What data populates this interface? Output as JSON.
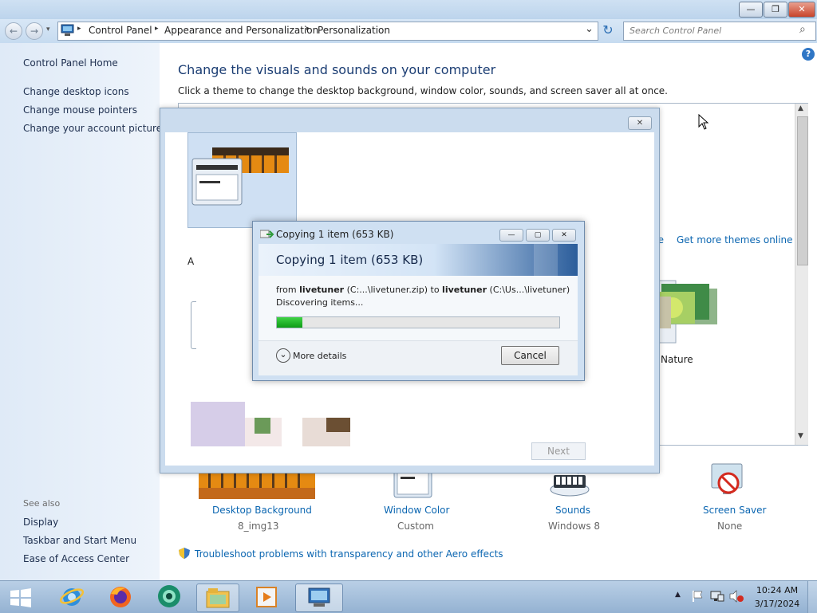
{
  "window": {
    "min_label": "—",
    "max_label": "❐",
    "close_label": "✕"
  },
  "nav": {
    "back_icon": "←",
    "forward_icon": "→",
    "recent_icon": "▾",
    "breadcrumb": [
      "Control Panel",
      "Appearance and Personalization",
      "Personalization"
    ],
    "sep": "▸",
    "dropdown_icon": "⌄",
    "refresh_icon": "↻",
    "search_placeholder": "Search Control Panel",
    "search_icon": "⌕"
  },
  "sidebar": {
    "home": "Control Panel Home",
    "links": [
      "Change desktop icons",
      "Change mouse pointers",
      "Change your account picture"
    ],
    "see_also_title": "See also",
    "see_also": [
      "Display",
      "Taskbar and Start Menu",
      "Ease of Access Center"
    ]
  },
  "main": {
    "title": "Change the visuals and sounds on your computer",
    "subtitle": "Click a theme to change the desktop background, window color, sounds, and screen saver all at once.",
    "help_icon": "?",
    "save_theme_fragment": "heme",
    "get_more_themes": "Get more themes online",
    "nature_label": "Nature",
    "partial_label": "A",
    "bottom_items": [
      {
        "label": "Desktop Background",
        "sub": "8_img13"
      },
      {
        "label": "Window Color",
        "sub": "Custom"
      },
      {
        "label": "Sounds",
        "sub": "Windows 8"
      },
      {
        "label": "Screen Saver",
        "sub": "None"
      }
    ],
    "troubleshoot": "Troubleshoot problems with transparency and other Aero effects"
  },
  "theme_dialog": {
    "close_label": "✕",
    "next_label": "Next"
  },
  "copy_dialog": {
    "title": "Copying 1 item (653 KB)",
    "header": "Copying 1 item (653 KB)",
    "from_word": "from",
    "src_name": "livetuner",
    "src_path": "(C:...\\livetuner.zip)",
    "to_word": "to",
    "dst_name": "livetuner",
    "dst_path": "(C:\\Us...\\livetuner)",
    "status": "Discovering items...",
    "progress": 0.09,
    "more_details_icon": "⌄",
    "more_details": "More details",
    "cancel": "Cancel",
    "min_label": "—",
    "max_label": "▢",
    "close_label": "✕"
  },
  "taskbar": {
    "time": "10:24 AM",
    "date": "3/17/2024"
  },
  "colors": {
    "link": "#0b66b1",
    "progress_fill": "#16b11f",
    "close_red": "#c8442b"
  }
}
